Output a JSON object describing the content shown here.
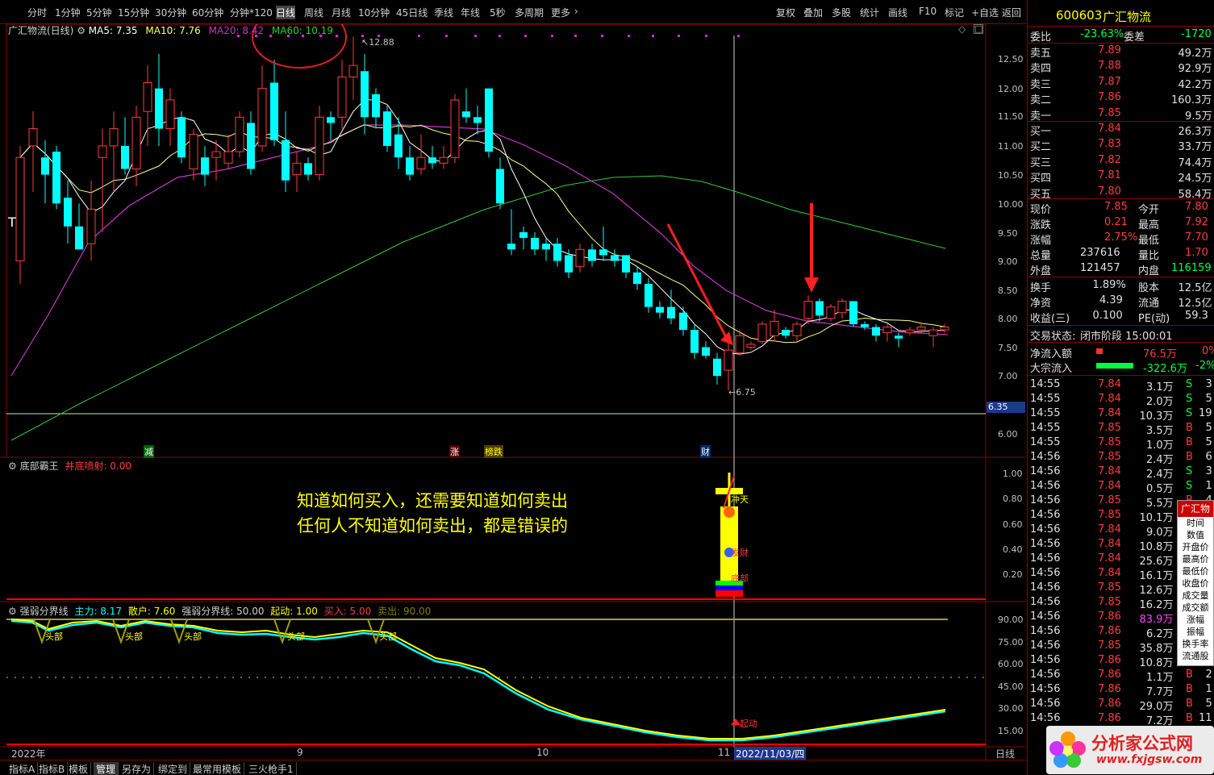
{
  "toolbar": {
    "periods": [
      "分时",
      "1分钟",
      "5分钟",
      "15分钟",
      "30分钟",
      "60分钟",
      "分钟*120",
      "日线",
      "周线",
      "月线",
      "10分钟",
      "45日线",
      "季线",
      "年线",
      "5秒",
      "多周期",
      "更多"
    ],
    "selected": "日线",
    "right_tools": [
      "复权",
      "叠加",
      "多股",
      "统计",
      "画线",
      "F10",
      "标记",
      "+自选",
      "返回"
    ]
  },
  "main_chart": {
    "title": "广汇物流(日线)",
    "ma5": "MA5: 7.35",
    "ma10": "MA10: 7.76",
    "ma20": "MA20: 8.42",
    "ma60": "MA60: 10.19",
    "high_label": "12.88",
    "low_label": "6.75",
    "price_ticks": [
      "12.50",
      "12.00",
      "11.50",
      "11.00",
      "10.50",
      "10.00",
      "9.50",
      "9.00",
      "8.50",
      "8.00",
      "7.50",
      "7.00",
      "6.00"
    ],
    "crosshair_price": "6.35",
    "markers": [
      "减",
      "涨",
      "榜跌",
      "财"
    ],
    "left_mark": "T"
  },
  "indicator1": {
    "title": "底部霸王",
    "param": "井底喷射: 0.00",
    "ticks": [
      "1.00",
      "0.80",
      "0.60",
      "0.40",
      "0.20"
    ],
    "annotation_line1": "知道如何买入，还需要知道如何卖出",
    "annotation_line2": "任何人不知道如何卖出，都是错误的",
    "labels": [
      "冲天",
      "发财",
      "底部"
    ]
  },
  "indicator2": {
    "title": "强弱分界线",
    "zhuli": "主力: 8.17",
    "sanhu": "散户: 7.60",
    "fenjie": "强弱分界线: 50.00",
    "qidong": "起动: 1.00",
    "mairu": "买入: 5.00",
    "maichu": "卖出: 90.00",
    "ticks": [
      "90.00",
      "75.00",
      "60.00",
      "45.00",
      "30.00",
      "15.00"
    ],
    "head_label": "头部",
    "start_label": "起动"
  },
  "date_axis": {
    "year": "2022年",
    "months": [
      "9",
      "10",
      "11"
    ],
    "cursor_date": "2022/11/03/四",
    "period": "日线"
  },
  "bottom_tabs": [
    "指标A",
    "指标B",
    "模板",
    "管理",
    "另存为",
    "绑定到",
    "最常用模板",
    "三火枪手1"
  ],
  "bottom_selected": "管理",
  "quote": {
    "code": "600603",
    "name": "广汇物流",
    "weibi_label": "委比",
    "weibi": "-23.63%",
    "weicha_label": "委差",
    "weicha": "-1720",
    "sell": [
      {
        "label": "卖五",
        "price": "7.89",
        "vol": "49.2万"
      },
      {
        "label": "卖四",
        "price": "7.88",
        "vol": "92.9万"
      },
      {
        "label": "卖三",
        "price": "7.87",
        "vol": "42.2万"
      },
      {
        "label": "卖二",
        "price": "7.86",
        "vol": "160.3万"
      },
      {
        "label": "卖一",
        "price": "7.85",
        "vol": "9.5万"
      }
    ],
    "buy": [
      {
        "label": "买一",
        "price": "7.84",
        "vol": "26.3万"
      },
      {
        "label": "买二",
        "price": "7.83",
        "vol": "33.7万"
      },
      {
        "label": "买三",
        "price": "7.82",
        "vol": "74.4万"
      },
      {
        "label": "买四",
        "price": "7.81",
        "vol": "24.5万"
      },
      {
        "label": "买五",
        "price": "7.80",
        "vol": "58.4万"
      }
    ],
    "stats": [
      {
        "l1": "现价",
        "v1": "7.85",
        "l2": "今开",
        "v2": "7.80"
      },
      {
        "l1": "涨跌",
        "v1": "0.21",
        "l2": "最高",
        "v2": "7.92"
      },
      {
        "l1": "涨幅",
        "v1": "2.75%",
        "l2": "最低",
        "v2": "7.70"
      },
      {
        "l1": "总量",
        "v1": "237616",
        "l2": "量比",
        "v2": "1.70"
      },
      {
        "l1": "外盘",
        "v1": "121457",
        "l2": "内盘",
        "v2": "116159"
      }
    ],
    "stats2": [
      {
        "l1": "换手",
        "v1": "1.89%",
        "l2": "股本",
        "v2": "12.5亿"
      },
      {
        "l1": "净资",
        "v1": "4.39",
        "l2": "流通",
        "v2": "12.5亿"
      },
      {
        "l1": "收益(三)",
        "v1": "0.100",
        "l2": "PE(动)",
        "v2": "59.3"
      }
    ],
    "trade_state_label": "交易状态:",
    "trade_state": "闭市阶段 15:00:01",
    "net_inflow_label": "净流入额",
    "net_inflow": "76.5万",
    "net_inflow_pct": "0%",
    "block_inflow_label": "大宗流入",
    "block_inflow": "-322.6万",
    "block_inflow_pct": "-2%",
    "ticks": [
      {
        "t": "14:55",
        "p": "7.84",
        "v": "3.1万",
        "bs": "S",
        "n": "3"
      },
      {
        "t": "14:55",
        "p": "7.84",
        "v": "2.0万",
        "bs": "S",
        "n": "5"
      },
      {
        "t": "14:55",
        "p": "7.84",
        "v": "10.3万",
        "bs": "S",
        "n": "19"
      },
      {
        "t": "14:55",
        "p": "7.85",
        "v": "3.5万",
        "bs": "B",
        "n": "5"
      },
      {
        "t": "14:55",
        "p": "7.85",
        "v": "1.0万",
        "bs": "B",
        "n": "5"
      },
      {
        "t": "14:56",
        "p": "7.85",
        "v": "2.4万",
        "bs": "B",
        "n": "6"
      },
      {
        "t": "14:56",
        "p": "7.84",
        "v": "2.4万",
        "bs": "S",
        "n": "3"
      },
      {
        "t": "14:56",
        "p": "7.84",
        "v": "0.5万",
        "bs": "S",
        "n": "1"
      },
      {
        "t": "14:56",
        "p": "7.85",
        "v": "5.5万",
        "bs": "B",
        "n": "4"
      },
      {
        "t": "14:56",
        "p": "7.85",
        "v": "10.1万",
        "bs": "B",
        "n": ""
      },
      {
        "t": "14:56",
        "p": "7.84",
        "v": "9.0万",
        "bs": "",
        "n": ""
      },
      {
        "t": "14:56",
        "p": "7.84",
        "v": "10.8万",
        "bs": "",
        "n": ""
      },
      {
        "t": "14:56",
        "p": "7.84",
        "v": "25.6万",
        "bs": "",
        "n": ""
      },
      {
        "t": "14:56",
        "p": "7.84",
        "v": "16.1万",
        "bs": "",
        "n": ""
      },
      {
        "t": "14:56",
        "p": "7.85",
        "v": "12.6万",
        "bs": "",
        "n": ""
      },
      {
        "t": "14:56",
        "p": "7.85",
        "v": "16.2万",
        "bs": "",
        "n": ""
      },
      {
        "t": "14:56",
        "p": "7.86",
        "v": "83.9万",
        "bs": "",
        "n": ""
      },
      {
        "t": "14:56",
        "p": "7.86",
        "v": "6.2万",
        "bs": "",
        "n": ""
      },
      {
        "t": "14:56",
        "p": "7.85",
        "v": "35.8万",
        "bs": "",
        "n": ""
      },
      {
        "t": "14:56",
        "p": "7.86",
        "v": "10.8万",
        "bs": "",
        "n": ""
      },
      {
        "t": "14:56",
        "p": "7.86",
        "v": "1.1万",
        "bs": "B",
        "n": "2"
      },
      {
        "t": "14:56",
        "p": "7.86",
        "v": "7.7万",
        "bs": "B",
        "n": "1"
      },
      {
        "t": "14:56",
        "p": "7.86",
        "v": "29.0万",
        "bs": "B",
        "n": "5"
      },
      {
        "t": "14:56",
        "p": "7.86",
        "v": "7.2万",
        "bs": "B",
        "n": "11"
      }
    ],
    "popup": [
      "广汇物流",
      "时间",
      "数值",
      "开盘价",
      "最高价",
      "最低价",
      "收盘价",
      "成交量",
      "成交额",
      "涨幅",
      "振幅",
      "换手率",
      "流通股"
    ]
  },
  "watermark": {
    "text": "分析家公式网",
    "url": "www.fxjgsw.com"
  },
  "colors": {
    "up": "#ff3c3c",
    "down": "#00ffff",
    "ma5": "#ffffff",
    "ma10": "#ffff66",
    "ma20": "#cc33cc",
    "ma60": "#33cc33",
    "accent_red": "#ff0000"
  }
}
